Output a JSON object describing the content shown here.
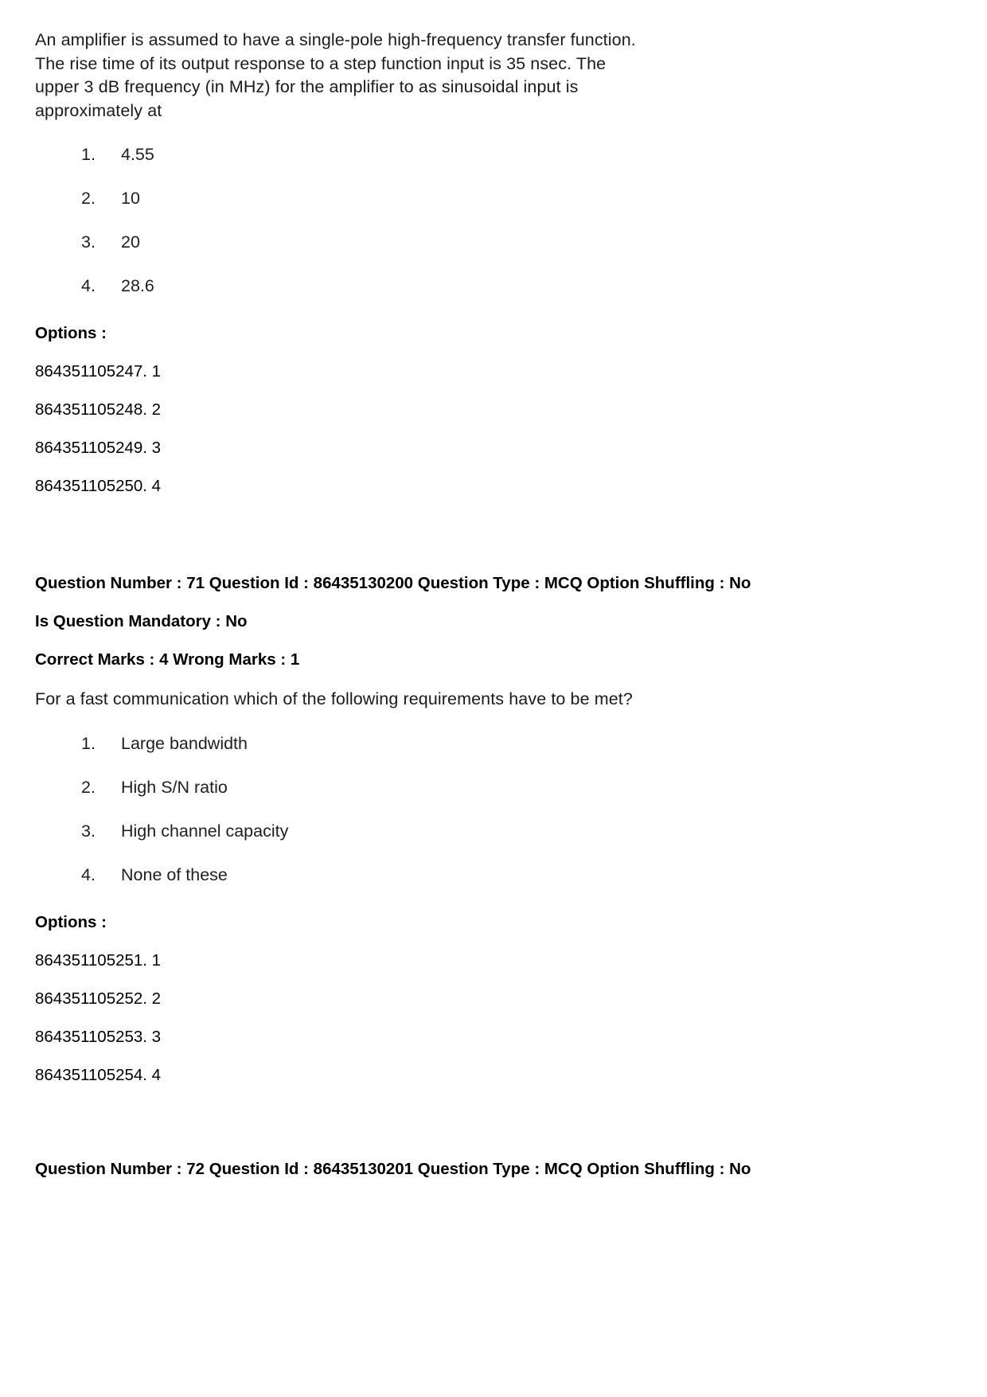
{
  "page": {
    "background_color": "#ffffff",
    "text_color": "#000000"
  },
  "questions": [
    {
      "stem_lines": [
        "An amplifier is assumed to have a single-pole high-frequency transfer function.",
        "The rise time of its output response to a step function input is 35 nsec. The",
        "upper 3 dB frequency (in MHz) for the amplifier to as sinusoidal input is",
        "approximately at"
      ],
      "stem_text": "An amplifier is assumed to have a single-pole high-frequency transfer function. The rise time of its output response to a step function input is 35 nsec. The upper 3 dB frequency (in MHz) for the amplifier to as sinusoidal input is approximately at",
      "choices": [
        {
          "num": "1.",
          "text": "4.55"
        },
        {
          "num": "2.",
          "text": "10"
        },
        {
          "num": "3.",
          "text": "20"
        },
        {
          "num": "4.",
          "text": "28.6"
        }
      ],
      "options_label": "Options :",
      "option_ids": [
        "864351105247. 1",
        "864351105248. 2",
        "864351105249. 3",
        "864351105250. 4"
      ]
    },
    {
      "header_line_1": "Question Number : 71 Question Id : 86435130200 Question Type : MCQ Option Shuffling : No",
      "header_line_2": "Is Question Mandatory : No",
      "header_line_3": "Correct Marks : 4 Wrong Marks : 1",
      "stem_text": "For a fast communication which of the following requirements have to be met?",
      "choices": [
        {
          "num": "1.",
          "text": "Large bandwidth"
        },
        {
          "num": "2.",
          "text": "High S/N ratio"
        },
        {
          "num": "3.",
          "text": "High channel capacity"
        },
        {
          "num": "4.",
          "text": "None of these"
        }
      ],
      "options_label": "Options :",
      "option_ids": [
        "864351105251. 1",
        "864351105252. 2",
        "864351105253. 3",
        "864351105254. 4"
      ]
    },
    {
      "header_line_1": "Question Number : 72 Question Id : 86435130201 Question Type : MCQ Option Shuffling : No"
    }
  ]
}
